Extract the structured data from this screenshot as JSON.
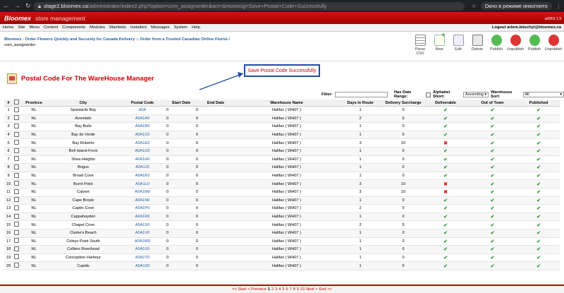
{
  "browser": {
    "host": "stage2.bloomex.ca",
    "path": "/administrator/index2.php?option=com_assignorder&act=&mosmsg=Save+Postal+Code+Successfully",
    "incognito": "Окно в режиме инкогнито"
  },
  "brand": {
    "logo": "Bloomex",
    "subtitle": "store management",
    "version": "w0001 1.9"
  },
  "menu": {
    "items": [
      "Home",
      "Site",
      "Menu",
      "Content",
      "Components",
      "Modules",
      "Mambots",
      "Installers",
      "Messages",
      "System",
      "Help"
    ],
    "user": "Logout artem.letuchyi@bloomex.ca"
  },
  "breadcrumb": {
    "site": "Bloomex - Order Flowers Quickly and Securely for Canada Delivery :: Order from a Trusted Canadian Online Florist /",
    "page": "com_assignorder"
  },
  "toolbar": [
    {
      "label": "Parse CSV",
      "icon": "csv"
    },
    {
      "label": "New",
      "icon": "new"
    },
    {
      "label": "Edit",
      "icon": "edit"
    },
    {
      "label": "Delete",
      "icon": "del"
    },
    {
      "label": "Publish",
      "icon": "pub"
    },
    {
      "label": "Unpublish",
      "icon": "unpub"
    },
    {
      "label": "Publish",
      "icon": "pub"
    },
    {
      "label": "Unpublish",
      "icon": "unpub"
    }
  ],
  "message": "Save Postal Code Successfully",
  "page_title": "Postal Code For The WareHouse Manager",
  "filters": {
    "filter_label": "Filter:",
    "date_range_label": "Has Date Range:",
    "alpha_sort_label": "Alphabet Short:",
    "alpha_sort_value": "Ascending",
    "warehouse_sort_label": "Warehouse Sort:",
    "warehouse_sort_value": "All"
  },
  "table": {
    "headers": [
      "#",
      "",
      "Province",
      "City",
      "Postal Code",
      "Start Date",
      "End Date",
      "Warehouse Name",
      "Days In Route",
      "Delivery Surcharge",
      "Deliverable",
      "Out of Town",
      "Published"
    ],
    "rows": [
      [
        "1",
        "NL",
        "Spaniards Bay",
        "A0A",
        "0",
        "0",
        "Halifax ( WH07 )",
        "1",
        "0",
        true
      ],
      [
        "2",
        "NL",
        "Avondale",
        "A0A1A0",
        "0",
        "0",
        "Halifax ( WH07 )",
        "2",
        "5",
        true
      ],
      [
        "3",
        "NL",
        "Bay Bulls",
        "A0A1B0",
        "0",
        "0",
        "Halifax ( WH07 )",
        "1",
        "0",
        true
      ],
      [
        "4",
        "NL",
        "Bay de Verde",
        "A0A1C0",
        "0",
        "0",
        "Halifax ( WH07 )",
        "1",
        "0",
        true
      ],
      [
        "5",
        "NL",
        "Bay Roberts",
        "A0A1E0",
        "0",
        "0",
        "Halifax ( WH07 )",
        "3",
        "10",
        false
      ],
      [
        "6",
        "NL",
        "Bell Island Front",
        "A0A1G0",
        "0",
        "0",
        "Halifax ( WH07 )",
        "1",
        "0",
        true
      ],
      [
        "7",
        "NL",
        "Shea Heights",
        "A0A1H0",
        "0",
        "0",
        "Halifax ( WH07 )",
        "1",
        "0",
        true
      ],
      [
        "8",
        "NL",
        "Brigus",
        "A0A1J0",
        "0",
        "0",
        "Halifax ( WH07 )",
        "1",
        "0",
        true
      ],
      [
        "9",
        "NL",
        "Broad Cove",
        "A0A1K0",
        "0",
        "0",
        "Halifax ( WH07 )",
        "1",
        "0",
        true
      ],
      [
        "10",
        "NL",
        "Burnt Point",
        "A0A1L0",
        "0",
        "0",
        "Halifax ( WH07 )",
        "3",
        "10",
        false
      ],
      [
        "11",
        "NL",
        "Calvert",
        "A0A1M0",
        "0",
        "0",
        "Halifax ( WH07 )",
        "3",
        "10",
        false
      ],
      [
        "12",
        "NL",
        "Cape Broyle",
        "A0A1N0",
        "0",
        "0",
        "Halifax ( WH07 )",
        "1",
        "0",
        true
      ],
      [
        "13",
        "NL",
        "Captin Cove",
        "A0A1P0",
        "0",
        "0",
        "Halifax ( WH07 )",
        "2",
        "5",
        true
      ],
      [
        "14",
        "NL",
        "Cappahayden",
        "A0A1R0",
        "0",
        "0",
        "Halifax ( WH07 )",
        "1",
        "0",
        true
      ],
      [
        "15",
        "NL",
        "Chapel Cove",
        "A0A1S0",
        "0",
        "0",
        "Halifax ( WH07 )",
        "2",
        "5",
        true
      ],
      [
        "16",
        "NL",
        "Clarke's Beach",
        "A0A1V0",
        "0",
        "0",
        "Halifax ( WH07 )",
        "1",
        "0",
        true
      ],
      [
        "17",
        "NL",
        "Coleys Point South",
        "A0A1W0",
        "0",
        "0",
        "Halifax ( WH07 )",
        "1",
        "0",
        true
      ],
      [
        "18",
        "NL",
        "Colliers Riverhead",
        "A0A1X0",
        "0",
        "0",
        "Halifax ( WH07 )",
        "1",
        "0",
        true
      ],
      [
        "19",
        "NL",
        "Conception Harbour",
        "A0A1Y0",
        "0",
        "0",
        "Halifax ( WH07 )",
        "1",
        "0",
        true
      ],
      [
        "20",
        "NL",
        "Cupids",
        "A0A1Z0",
        "0",
        "0",
        "Halifax ( WH07 )",
        "1",
        "0",
        true
      ]
    ]
  },
  "pager": {
    "start": "<< Start",
    "prev": "< Previous",
    "pages": [
      "1",
      "2",
      "3",
      "4",
      "5",
      "6",
      "7",
      "8",
      "9",
      "10"
    ],
    "next": "Next >",
    "end": "End >>"
  }
}
